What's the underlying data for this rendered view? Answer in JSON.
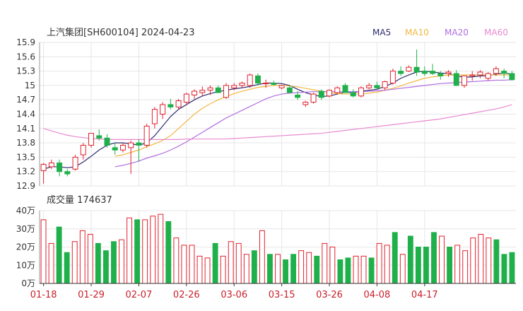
{
  "title": "上汽集团[SH600104] 2024-04-23",
  "legend": [
    {
      "label": "MA5",
      "color": "#2b2b6e"
    },
    {
      "label": "MA10",
      "color": "#f2b740"
    },
    {
      "label": "MA20",
      "color": "#b06ee0"
    },
    {
      "label": "MA60",
      "color": "#e889cf"
    }
  ],
  "colors": {
    "up": "#e0222e",
    "down": "#1fb04b",
    "grid": "#e6e6e6",
    "axis": "#333333",
    "date": "#c8202a"
  },
  "volume_label": "成交量 174637",
  "chart_data": [
    {
      "type": "candlestick",
      "title": "上汽集团[SH600104] 2024-04-23",
      "ylim": [
        12.9,
        15.9
      ],
      "yticks": [
        "15.9",
        "15.6",
        "15.3",
        "15",
        "14.7",
        "14.4",
        "14.1",
        "13.8",
        "13.5",
        "13.2",
        "12.9"
      ],
      "x_tick_labels": [
        "01-18",
        "01-29",
        "02-07",
        "02-26",
        "03-06",
        "03-15",
        "03-26",
        "04-08",
        "04-17"
      ],
      "x_tick_index": [
        0,
        6,
        12,
        18,
        24,
        30,
        36,
        42,
        48
      ],
      "ohlc": [
        [
          13.22,
          13.38,
          12.95,
          13.35
        ],
        [
          13.3,
          13.45,
          13.25,
          13.38
        ],
        [
          13.38,
          13.45,
          13.1,
          13.2
        ],
        [
          13.2,
          13.25,
          13.1,
          13.15
        ],
        [
          13.25,
          13.55,
          13.22,
          13.5
        ],
        [
          13.55,
          13.8,
          13.45,
          13.75
        ],
        [
          13.75,
          14.0,
          13.7,
          14.0
        ],
        [
          13.95,
          14.08,
          13.85,
          13.9
        ],
        [
          13.9,
          13.98,
          13.7,
          13.75
        ],
        [
          13.7,
          13.8,
          13.55,
          13.65
        ],
        [
          13.65,
          13.8,
          13.6,
          13.75
        ],
        [
          13.7,
          13.85,
          13.15,
          13.8
        ],
        [
          13.8,
          13.88,
          13.4,
          13.75
        ],
        [
          13.75,
          14.2,
          13.7,
          14.15
        ],
        [
          14.2,
          14.55,
          14.1,
          14.5
        ],
        [
          14.4,
          14.65,
          14.3,
          14.6
        ],
        [
          14.6,
          14.72,
          14.5,
          14.55
        ],
        [
          14.55,
          14.72,
          14.5,
          14.68
        ],
        [
          14.65,
          14.85,
          14.6,
          14.82
        ],
        [
          14.8,
          14.92,
          14.72,
          14.88
        ],
        [
          14.85,
          14.98,
          14.78,
          14.9
        ],
        [
          14.9,
          15.0,
          14.8,
          14.95
        ],
        [
          14.95,
          15.0,
          14.85,
          14.85
        ],
        [
          14.75,
          15.05,
          14.72,
          15.0
        ],
        [
          14.95,
          15.05,
          14.9,
          15.0
        ],
        [
          15.0,
          15.08,
          14.95,
          15.05
        ],
        [
          15.0,
          15.25,
          14.95,
          15.22
        ],
        [
          15.2,
          15.25,
          15.0,
          15.05
        ],
        [
          15.05,
          15.12,
          14.95,
          15.05
        ],
        [
          15.05,
          15.1,
          15.0,
          15.02
        ],
        [
          14.95,
          15.02,
          14.92,
          15.0
        ],
        [
          14.95,
          15.0,
          14.85,
          14.85
        ],
        [
          14.8,
          14.88,
          14.7,
          14.75
        ],
        [
          14.6,
          14.68,
          14.55,
          14.65
        ],
        [
          14.65,
          14.85,
          14.62,
          14.82
        ],
        [
          14.88,
          14.92,
          14.7,
          14.75
        ],
        [
          14.78,
          14.92,
          14.75,
          14.9
        ],
        [
          14.85,
          14.98,
          14.82,
          14.95
        ],
        [
          15.0,
          15.05,
          14.85,
          14.85
        ],
        [
          14.85,
          14.92,
          14.75,
          14.78
        ],
        [
          14.78,
          14.98,
          14.75,
          14.95
        ],
        [
          14.95,
          15.05,
          14.92,
          15.0
        ],
        [
          15.0,
          15.08,
          14.92,
          14.95
        ],
        [
          14.95,
          15.1,
          14.9,
          15.08
        ],
        [
          15.05,
          15.35,
          15.02,
          15.3
        ],
        [
          15.3,
          15.4,
          15.2,
          15.25
        ],
        [
          15.3,
          15.42,
          15.28,
          15.38
        ],
        [
          15.38,
          15.75,
          15.2,
          15.28
        ],
        [
          15.3,
          15.4,
          15.2,
          15.25
        ],
        [
          15.3,
          15.45,
          15.22,
          15.25
        ],
        [
          15.25,
          15.3,
          15.12,
          15.2
        ],
        [
          15.25,
          15.32,
          15.18,
          15.28
        ],
        [
          15.25,
          15.32,
          15.0,
          15.0
        ],
        [
          15.0,
          15.1,
          14.95,
          15.2
        ],
        [
          15.2,
          15.3,
          15.1,
          15.22
        ],
        [
          15.22,
          15.32,
          15.15,
          15.28
        ],
        [
          15.15,
          15.28,
          15.1,
          15.25
        ],
        [
          15.25,
          15.4,
          15.2,
          15.35
        ],
        [
          15.3,
          15.35,
          15.15,
          15.25
        ],
        [
          15.25,
          15.3,
          15.1,
          15.12
        ]
      ],
      "ma": {
        "MA5": [
          13.25,
          13.3,
          13.3,
          13.28,
          13.3,
          13.4,
          13.52,
          13.65,
          13.75,
          13.8,
          13.8,
          13.78,
          13.75,
          13.8,
          13.95,
          14.15,
          14.35,
          14.5,
          14.6,
          14.7,
          14.78,
          14.83,
          14.87,
          14.9,
          14.93,
          14.95,
          14.98,
          15.02,
          15.05,
          15.05,
          15.04,
          15.0,
          14.92,
          14.85,
          14.8,
          14.77,
          14.78,
          14.82,
          14.86,
          14.85,
          14.88,
          14.9,
          14.92,
          14.98,
          15.05,
          15.15,
          15.22,
          15.28,
          15.3,
          15.28,
          15.26,
          15.25,
          15.2,
          15.17,
          15.18,
          15.2,
          15.2,
          15.24,
          15.26,
          15.24
        ],
        "MA10": [
          null,
          null,
          null,
          null,
          null,
          null,
          null,
          null,
          null,
          13.52,
          13.55,
          13.6,
          13.65,
          13.72,
          13.78,
          13.85,
          13.95,
          14.1,
          14.25,
          14.4,
          14.52,
          14.62,
          14.7,
          14.77,
          14.83,
          14.88,
          14.92,
          14.96,
          14.98,
          15.0,
          15.0,
          14.99,
          14.97,
          14.94,
          14.91,
          14.88,
          14.85,
          14.83,
          14.82,
          14.82,
          14.82,
          14.84,
          14.86,
          14.9,
          14.94,
          14.99,
          15.05,
          15.1,
          15.15,
          15.18,
          15.2,
          15.22,
          15.22,
          15.22,
          15.22,
          15.22,
          15.22,
          15.22,
          15.22,
          15.22
        ],
        "MA20": [
          null,
          null,
          null,
          null,
          null,
          null,
          null,
          null,
          null,
          13.3,
          13.33,
          13.37,
          13.42,
          13.48,
          13.53,
          13.58,
          13.65,
          13.73,
          13.82,
          13.92,
          14.02,
          14.12,
          14.22,
          14.32,
          14.4,
          14.48,
          14.56,
          14.64,
          14.72,
          14.78,
          14.82,
          14.84,
          14.85,
          14.86,
          14.87,
          14.87,
          14.87,
          14.87,
          14.87,
          14.87,
          14.87,
          14.88,
          14.89,
          14.9,
          14.92,
          14.94,
          14.96,
          14.98,
          15.0,
          15.02,
          15.04,
          15.05,
          15.06,
          15.07,
          15.08,
          15.09,
          15.1,
          15.11,
          15.11,
          15.12
        ],
        "MA60": [
          14.1,
          14.05,
          14.0,
          13.96,
          13.93,
          13.91,
          13.89,
          13.88,
          13.87,
          13.87,
          13.87,
          13.87,
          13.87,
          13.87,
          13.87,
          13.87,
          13.87,
          13.87,
          13.88,
          13.88,
          13.88,
          13.88,
          13.88,
          13.88,
          13.89,
          13.9,
          13.91,
          13.92,
          13.93,
          13.94,
          13.95,
          13.96,
          13.97,
          13.98,
          13.99,
          14.0,
          14.02,
          14.04,
          14.06,
          14.08,
          14.1,
          14.12,
          14.14,
          14.16,
          14.18,
          14.2,
          14.22,
          14.24,
          14.26,
          14.28,
          14.3,
          14.33,
          14.36,
          14.39,
          14.42,
          14.45,
          14.48,
          14.51,
          14.55,
          14.6
        ]
      }
    },
    {
      "type": "bar",
      "title": "成交量 174637",
      "ylim": [
        0,
        40
      ],
      "ytick_values": [
        0,
        10,
        20,
        30,
        40
      ],
      "yticks": [
        "0万",
        "10万",
        "20万",
        "30万",
        "40万"
      ],
      "values": [
        35,
        22,
        31,
        17,
        23,
        29,
        27,
        22,
        18,
        23,
        24,
        36,
        35,
        35,
        37,
        38,
        34,
        25,
        21,
        21,
        15,
        14,
        22,
        15,
        23,
        22,
        16,
        18,
        29,
        16,
        16,
        13,
        16,
        18,
        17,
        15,
        22,
        20,
        13,
        14,
        15,
        15,
        14,
        22,
        21,
        28,
        16,
        26,
        20,
        20,
        28,
        26,
        20,
        21,
        18,
        25,
        27,
        25,
        24,
        16,
        17
      ]
    }
  ]
}
